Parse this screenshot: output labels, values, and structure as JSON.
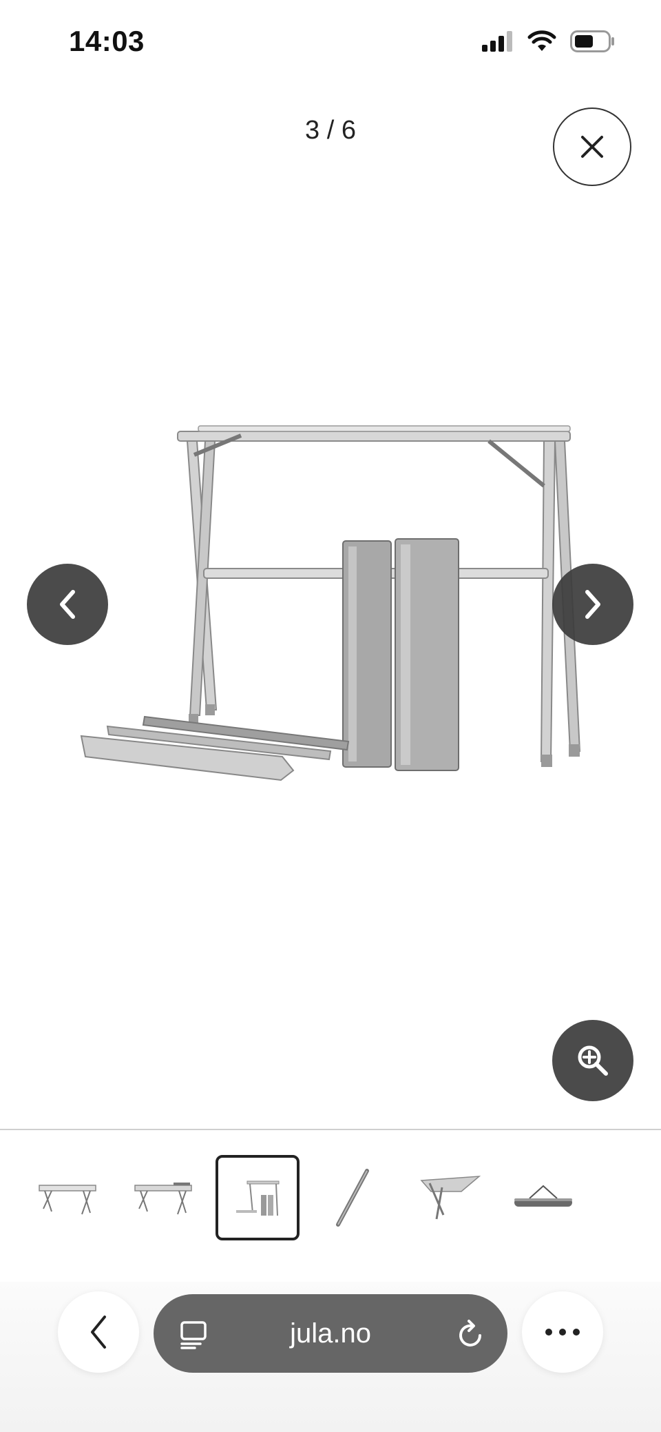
{
  "status_bar": {
    "time": "14:03",
    "icons": [
      "cellular-signal-icon",
      "wifi-icon",
      "battery-icon"
    ]
  },
  "gallery": {
    "counter": "3 / 6",
    "current_index": 3,
    "total": 6,
    "close_icon": "close-icon",
    "prev_icon": "chevron-left-icon",
    "next_icon": "chevron-right-icon",
    "zoom_icon": "zoom-in-icon",
    "thumbnails": [
      {
        "icon": "table-thumbnail-1",
        "selected": false
      },
      {
        "icon": "table-thumbnail-2",
        "selected": false
      },
      {
        "icon": "table-thumbnail-3",
        "selected": true
      },
      {
        "icon": "table-thumbnail-4",
        "selected": false
      },
      {
        "icon": "table-thumbnail-5",
        "selected": false
      },
      {
        "icon": "table-thumbnail-6",
        "selected": false
      }
    ]
  },
  "browser": {
    "url": "jula.no",
    "back_icon": "chevron-left-icon",
    "tabs_icon": "tabs-icon",
    "reload_icon": "reload-icon",
    "more_icon": "more-icon"
  },
  "colors": {
    "nav_button": "#3c3c3c",
    "url_pill": "#666666",
    "selected_thumb_border": "#222222"
  }
}
